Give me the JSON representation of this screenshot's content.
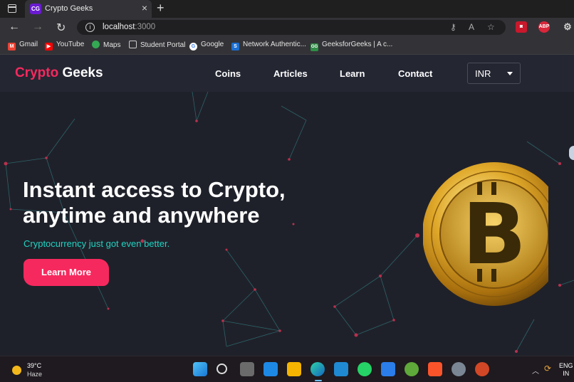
{
  "browser": {
    "tab_title": "Crypto Geeks",
    "tab_favicon_text": "CG",
    "url_host": "localhost",
    "url_port": ":3000",
    "bookmarks": [
      {
        "label": "Gmail",
        "icon": "gmail-icon",
        "color": "#ea4335",
        "glyph": "M"
      },
      {
        "label": "YouTube",
        "icon": "youtube-icon",
        "color": "#ff0000",
        "glyph": "▶"
      },
      {
        "label": "Maps",
        "icon": "maps-icon",
        "color": "#34a853",
        "glyph": "●"
      },
      {
        "label": "Student Portal",
        "icon": "page-icon",
        "color": "#555555",
        "glyph": ""
      },
      {
        "label": "Google",
        "icon": "google-icon",
        "color": "#4285f4",
        "glyph": "G"
      },
      {
        "label": "Network Authentic...",
        "icon": "network-icon",
        "color": "#1c6fd1",
        "glyph": "S"
      },
      {
        "label": "GeeksforGeeks | A c...",
        "icon": "gfg-icon",
        "color": "#2f8d46",
        "glyph": "GG"
      }
    ]
  },
  "site": {
    "logo_part1": "Crypto",
    "logo_part2": "Geeks",
    "nav": [
      "Coins",
      "Articles",
      "Learn",
      "Contact"
    ],
    "currency": "INR",
    "headline_line1": "Instant access to Crypto,",
    "headline_line2": "anytime and anywhere",
    "subhead": "Cryptocurrency just got even better.",
    "cta": "Learn More",
    "accent_color": "#f6295e",
    "teal_color": "#20d3c2"
  },
  "taskbar": {
    "temperature": "39°C",
    "weather": "Haze",
    "lang_line1": "ENG",
    "lang_line2": "IN"
  }
}
